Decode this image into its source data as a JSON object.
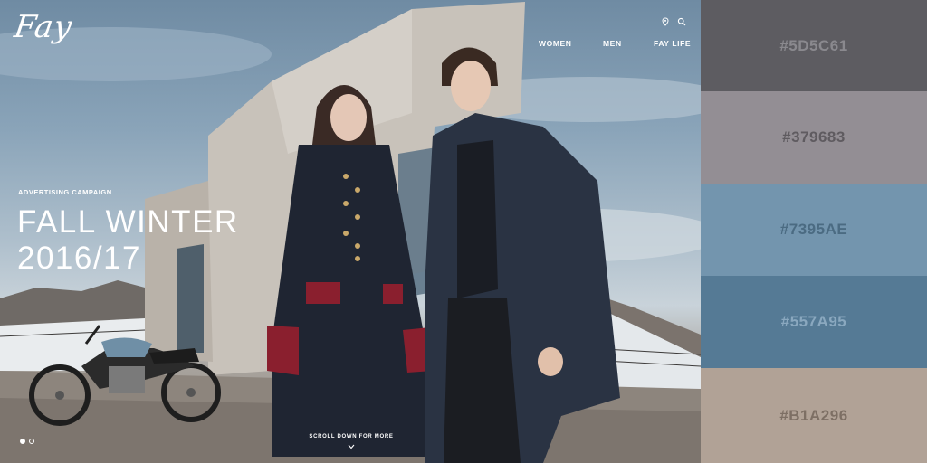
{
  "brand": {
    "logo_text": "Fay"
  },
  "utility_icons": [
    "location-pin-icon",
    "search-icon"
  ],
  "nav": {
    "items": [
      {
        "label": "WOMEN"
      },
      {
        "label": "MEN"
      },
      {
        "label": "FAY LIFE"
      }
    ]
  },
  "hero": {
    "kicker": "ADVERTISING CAMPAIGN",
    "headline_line1": "FALL WINTER",
    "headline_line2": "2016/17",
    "scroll_label": "SCROLL DOWN FOR MORE",
    "slide_count": 2,
    "active_slide": 1
  },
  "palette": {
    "swatches": [
      {
        "label": "#5D5C61",
        "color": "#5D5C61",
        "text_color": "#8a898e"
      },
      {
        "label": "#379683",
        "color": "#938E94",
        "text_color": "#5f5b60"
      },
      {
        "label": "#7395AE",
        "color": "#7395AE",
        "text_color": "#4b6b82"
      },
      {
        "label": "#557A95",
        "color": "#557A95",
        "text_color": "#8aa8bf"
      },
      {
        "label": "#B1A296",
        "color": "#B1A296",
        "text_color": "#7d6f64"
      }
    ]
  }
}
